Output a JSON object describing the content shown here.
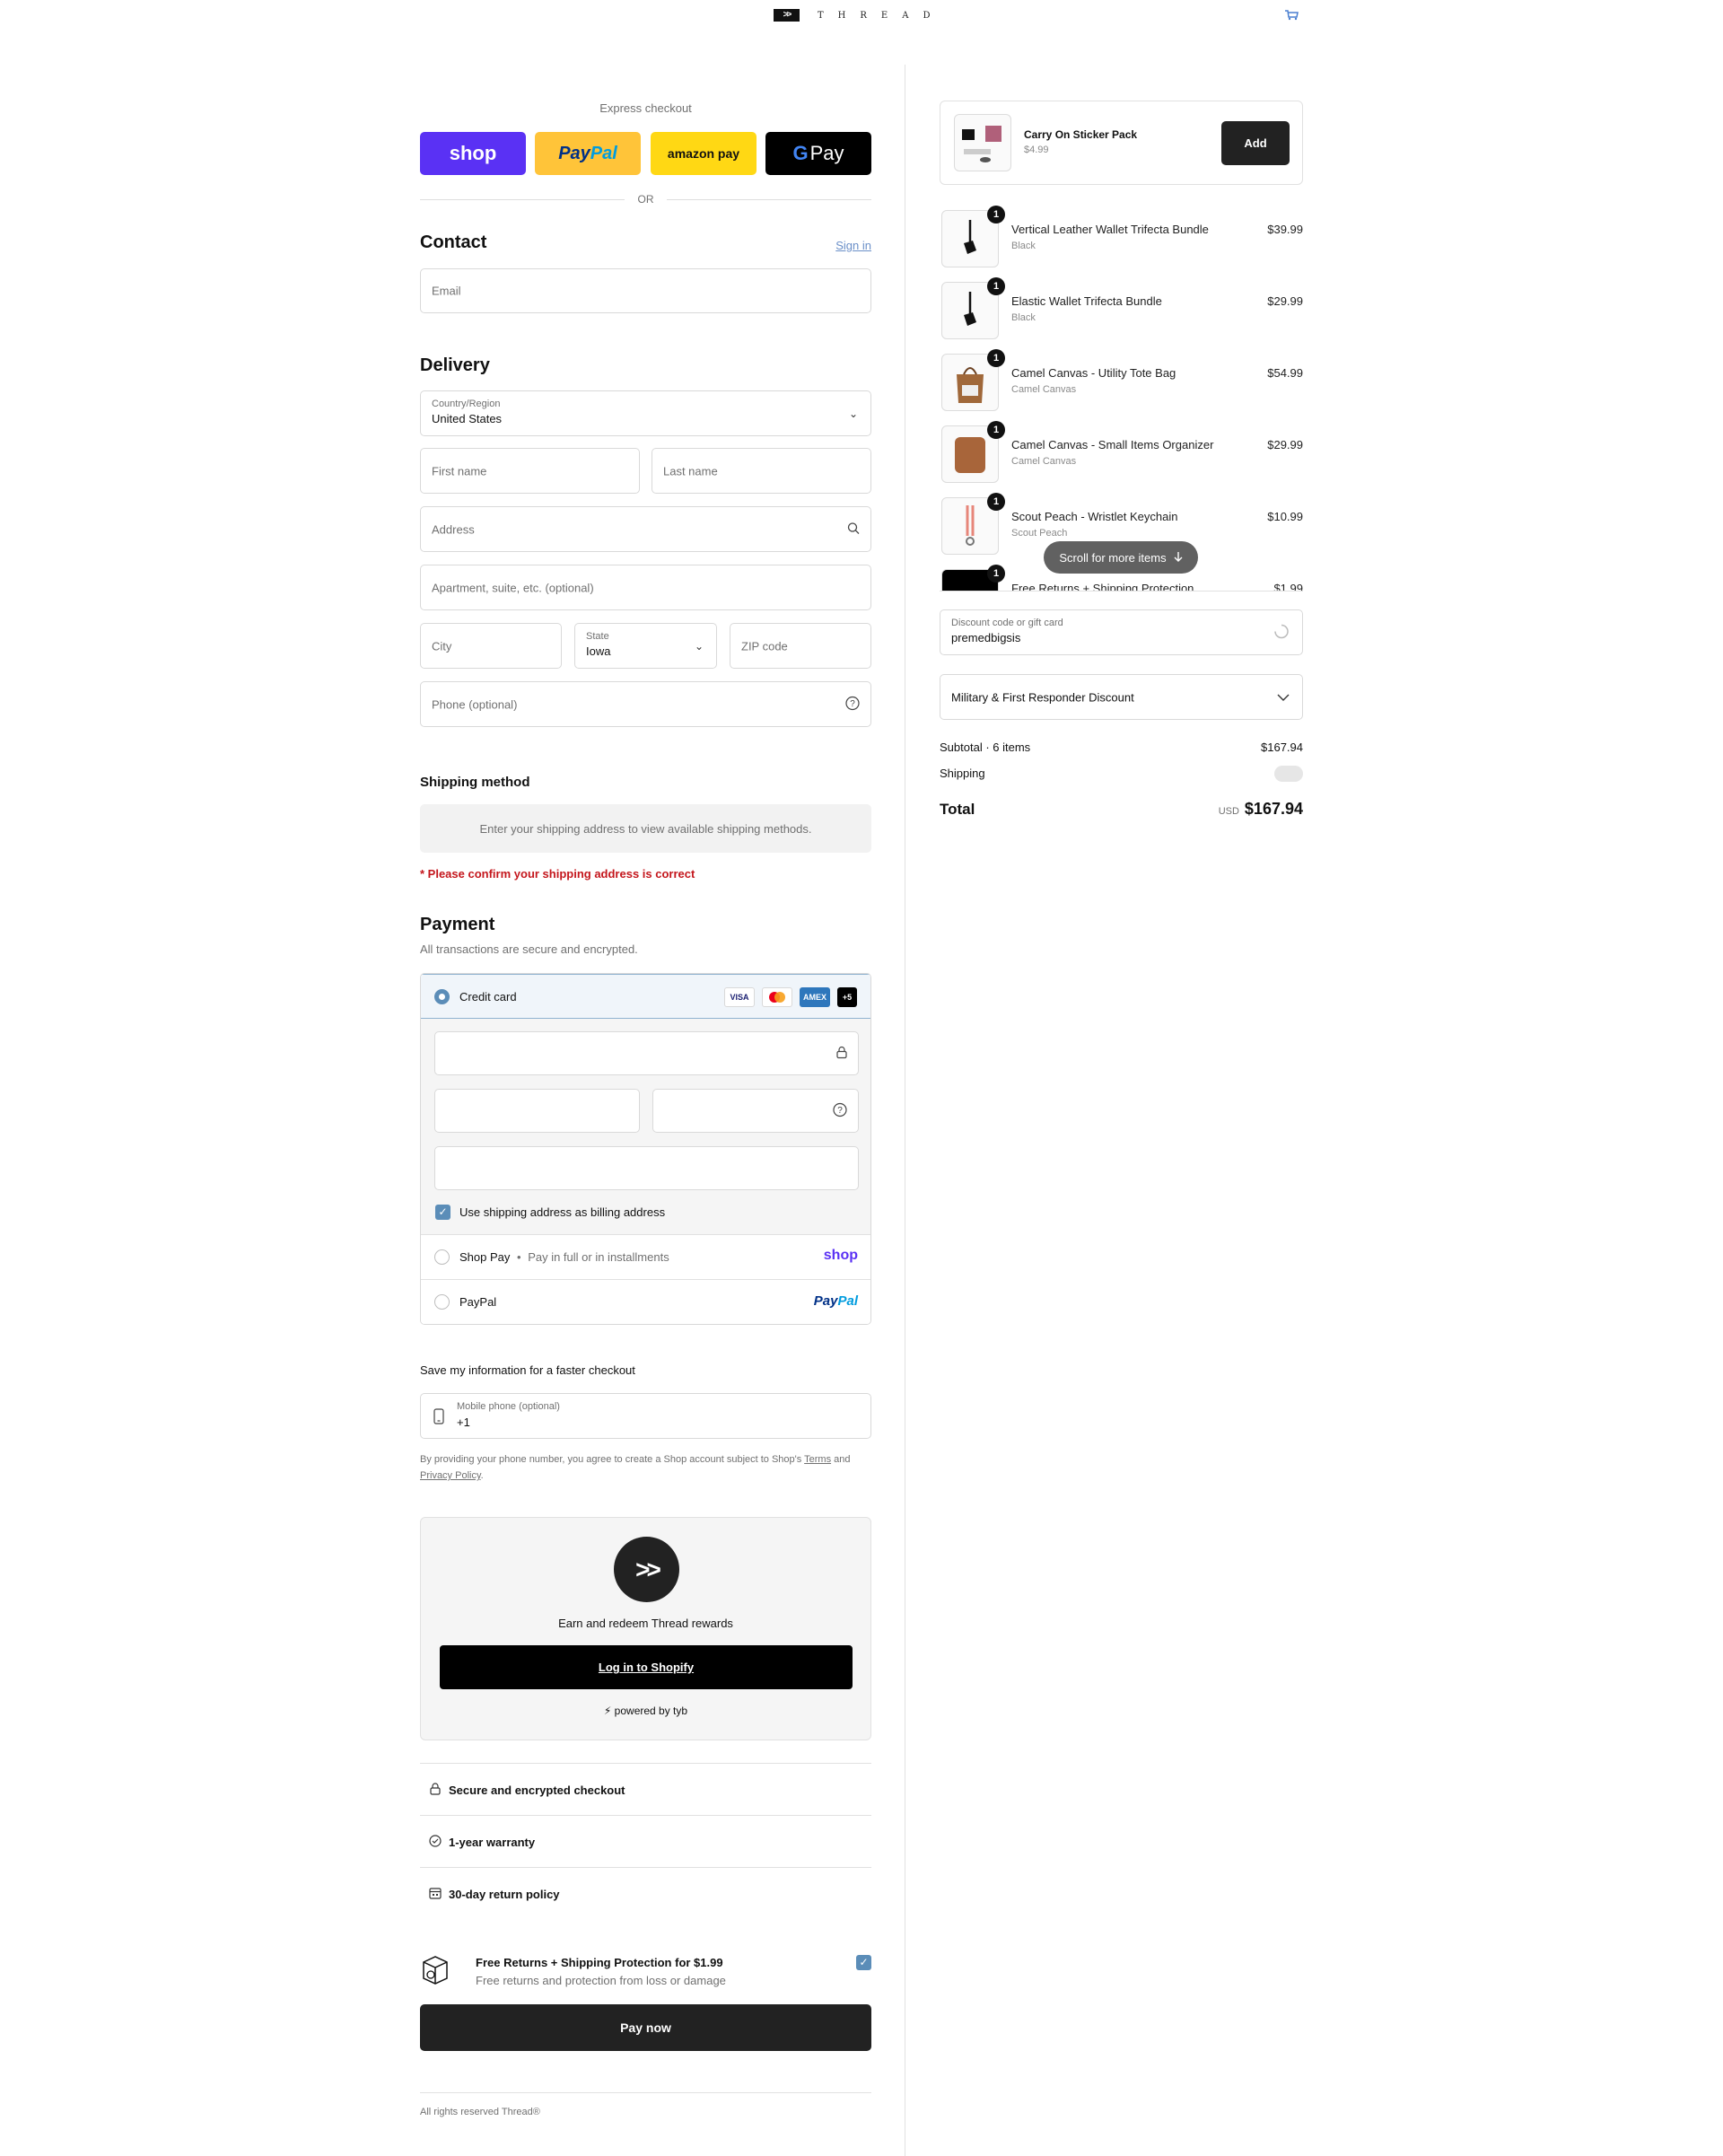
{
  "header": {
    "brand": "THREAD",
    "logo_mark": ">>",
    "cart_icon": "cart-icon"
  },
  "express": {
    "title": "Express checkout",
    "shop": "shop",
    "paypal_a": "Pay",
    "paypal_b": "Pal",
    "amazon": "amazon pay",
    "gpay_g": "G",
    "gpay": "Pay",
    "or": "OR"
  },
  "contact": {
    "title": "Contact",
    "sign_in": "Sign in",
    "email_placeholder": "Email"
  },
  "delivery": {
    "title": "Delivery",
    "country_label": "Country/Region",
    "country_value": "United States",
    "first_name": "First name",
    "last_name": "Last name",
    "address": "Address",
    "apartment": "Apartment, suite, etc. (optional)",
    "city": "City",
    "state_label": "State",
    "state_value": "Iowa",
    "zip": "ZIP code",
    "phone": "Phone (optional)"
  },
  "shipping": {
    "title": "Shipping method",
    "message": "Enter your shipping address to view available shipping methods.",
    "warning": "* Please confirm your shipping address is correct"
  },
  "payment": {
    "title": "Payment",
    "subtitle": "All transactions are secure and encrypted.",
    "credit_card": "Credit card",
    "card_logos": [
      "VISA",
      "MC",
      "AMEX",
      "+5"
    ],
    "billing_same": "Use shipping address as billing address",
    "shop_pay": "Shop Pay",
    "shop_pay_sep": "•",
    "shop_pay_desc": "Pay in full or in installments",
    "shop_logo": "shop",
    "paypal": "PayPal",
    "paypal_logo_a": "Pay",
    "paypal_logo_b": "Pal"
  },
  "save_info": {
    "title": "Save my information for a faster checkout",
    "mobile_label": "Mobile phone (optional)",
    "mobile_value": "+1",
    "terms_pre": "By providing your phone number, you agree to create a Shop account subject to Shop's",
    "terms_link": "Terms",
    "terms_and": "and",
    "privacy_link": "Privacy Policy",
    "terms_end": "."
  },
  "rewards": {
    "logo": ">>",
    "text": "Earn and redeem Thread rewards",
    "login": "Log in to Shopify",
    "powered": "⚡ powered by tyb"
  },
  "trust": [
    {
      "icon": "lock-icon",
      "glyph": "🔒",
      "label": "Secure and encrypted checkout"
    },
    {
      "icon": "check-circle-icon",
      "glyph": "✓",
      "label": "1-year warranty"
    },
    {
      "icon": "calendar-icon",
      "glyph": "▦",
      "label": "30-day return policy"
    }
  ],
  "protection": {
    "title": "Free Returns + Shipping Protection for $1.99",
    "subtitle": "Free returns and protection from loss or damage"
  },
  "pay_now": "Pay now",
  "footer": "All rights reserved Thread®",
  "upsell": {
    "title": "Carry On Sticker Pack",
    "price": "$4.99",
    "add": "Add"
  },
  "cart_items": [
    {
      "qty": "1",
      "title": "Vertical Leather Wallet Trifecta Bundle",
      "variant": "Black",
      "price": "$39.99"
    },
    {
      "qty": "1",
      "title": "Elastic Wallet Trifecta Bundle",
      "variant": "Black",
      "price": "$29.99"
    },
    {
      "qty": "1",
      "title": "Camel Canvas - Utility Tote Bag",
      "variant": "Camel Canvas",
      "price": "$54.99"
    },
    {
      "qty": "1",
      "title": "Camel Canvas - Small Items Organizer",
      "variant": "Camel Canvas",
      "price": "$29.99"
    },
    {
      "qty": "1",
      "title": "Scout Peach - Wristlet Keychain",
      "variant": "Scout Peach",
      "price": "$10.99"
    },
    {
      "qty": "1",
      "title": "Free Returns + Shipping Protection",
      "variant": "",
      "price": "$1.99"
    }
  ],
  "scroll_hint": "Scroll for more items",
  "discount": {
    "label": "Discount code or gift card",
    "value": "premedbigsis"
  },
  "military": "Military & First Responder Discount",
  "summary": {
    "subtotal_label": "Subtotal · 6 items",
    "subtotal_value": "$167.94",
    "shipping_label": "Shipping",
    "total_label": "Total",
    "currency": "USD",
    "total_value": "$167.94"
  },
  "colors": {
    "shop_purple": "#5a31f4",
    "paypal_yellow": "#ffc439",
    "amazon_yellow": "#ffd814",
    "accent_blue": "#5b8db8",
    "warning_red": "#c4161c",
    "primary_dark": "#222222"
  }
}
